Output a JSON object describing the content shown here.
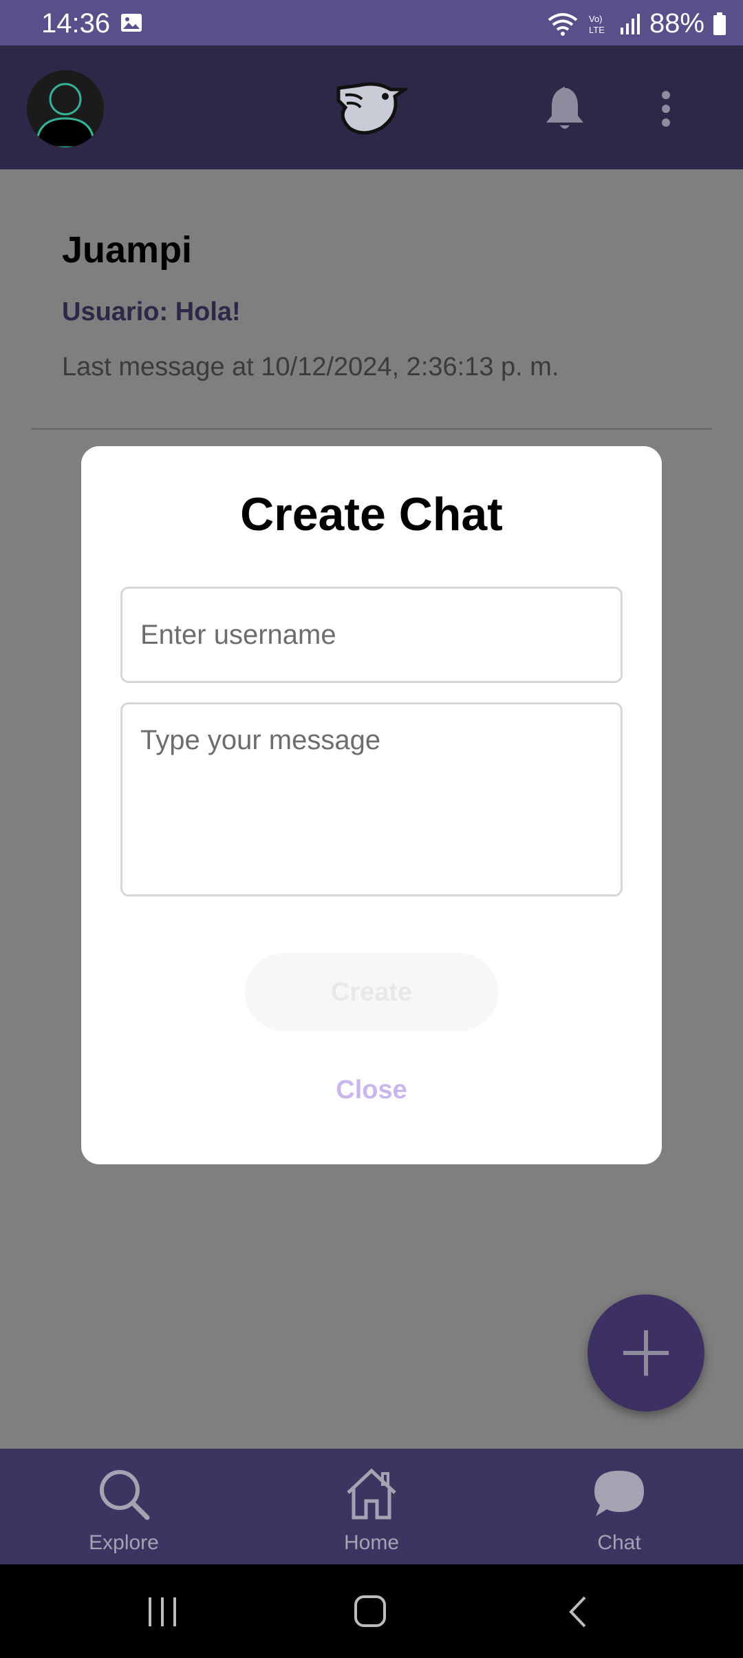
{
  "status_bar": {
    "time": "14:36",
    "battery": "88%",
    "icons": [
      "gallery-icon",
      "wifi-icon",
      "volte-icon",
      "signal-icon",
      "battery-icon"
    ]
  },
  "header": {
    "icons": [
      "avatar",
      "app-logo",
      "bell-icon",
      "more-vert-icon"
    ]
  },
  "chat_list": [
    {
      "name": "Juampi",
      "last_message": "Usuario: Hola!",
      "timestamp": "Last message at 10/12/2024, 2:36:13 p. m."
    }
  ],
  "modal": {
    "title": "Create Chat",
    "username_placeholder": "Enter username",
    "username_value": "",
    "message_placeholder": "Type your message",
    "message_value": "",
    "create_label": "Create",
    "close_label": "Close"
  },
  "bottom_nav": {
    "items": [
      {
        "label": "Explore",
        "icon": "search-icon"
      },
      {
        "label": "Home",
        "icon": "home-icon"
      },
      {
        "label": "Chat",
        "icon": "chat-bubble-icon"
      }
    ]
  },
  "colors": {
    "status_bar": "#5b4f8b",
    "header": "#2f2748",
    "accent": "#3d3164",
    "overlay": "#7f7f7f",
    "close_text": "#c8b6ec"
  }
}
